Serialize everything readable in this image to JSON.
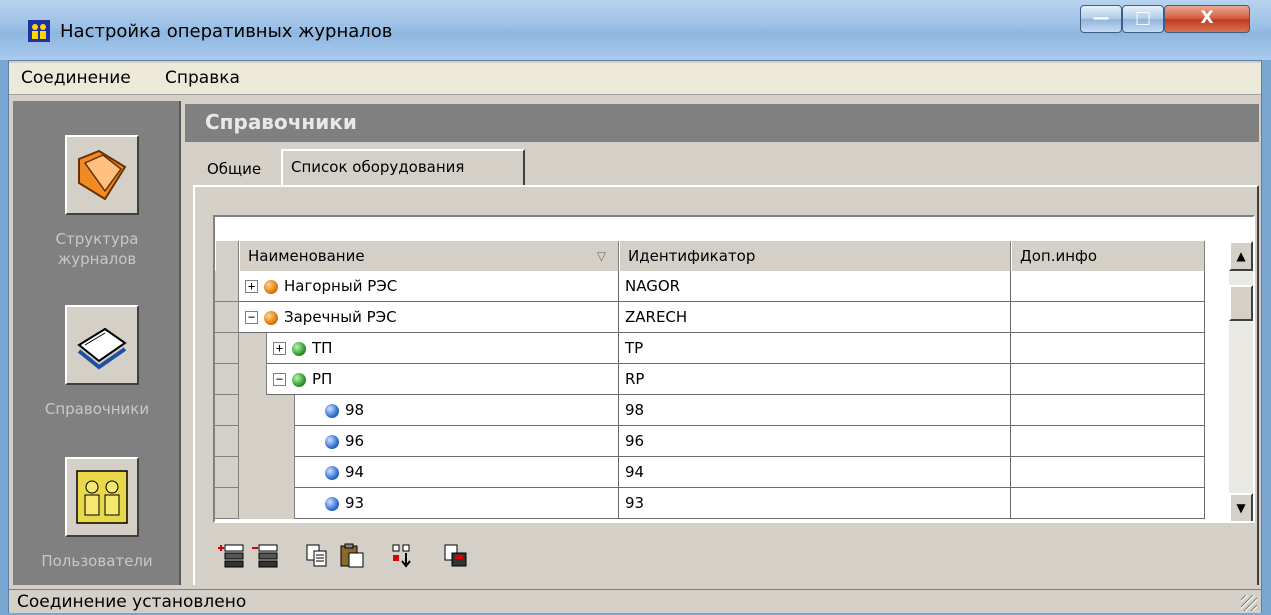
{
  "window": {
    "title": "Настройка оперативных журналов",
    "minimize_glyph": "—",
    "maximize_glyph": "□",
    "close_glyph": "X"
  },
  "menu": {
    "items": [
      "Соединение",
      "Справка"
    ]
  },
  "sidebar": {
    "buttons": [
      {
        "label_line1": "Структура",
        "label_line2": "журналов",
        "icon": "folder-icon"
      },
      {
        "label_line1": "Справочники",
        "label_line2": "",
        "icon": "books-icon"
      },
      {
        "label_line1": "Пользователи",
        "label_line2": "",
        "icon": "users-icon"
      }
    ]
  },
  "panel": {
    "title": "Справочники",
    "tabs": [
      "Общие",
      "Список оборудования"
    ],
    "active_tab": "Список оборудования"
  },
  "grid": {
    "columns": [
      "Наименование",
      "Идентификатор",
      "Доп.инфо"
    ],
    "sort_glyph": "▽",
    "rows": [
      {
        "name": "Нагорный РЭС",
        "id": "NAGOR",
        "extra": "",
        "level": 0,
        "expander": "+",
        "icon": "orange"
      },
      {
        "name": "Заречный РЭС",
        "id": "ZARECH",
        "extra": "",
        "level": 0,
        "expander": "−",
        "icon": "orange"
      },
      {
        "name": "ТП",
        "id": "TP",
        "extra": "",
        "level": 1,
        "expander": "+",
        "icon": "green"
      },
      {
        "name": "РП",
        "id": "RP",
        "extra": "",
        "level": 1,
        "expander": "−",
        "icon": "green"
      },
      {
        "name": "98",
        "id": "98",
        "extra": "",
        "level": 2,
        "expander": "",
        "icon": "blue"
      },
      {
        "name": "96",
        "id": "96",
        "extra": "",
        "level": 2,
        "expander": "",
        "icon": "blue"
      },
      {
        "name": "94",
        "id": "94",
        "extra": "",
        "level": 2,
        "expander": "",
        "icon": "blue"
      },
      {
        "name": "93",
        "id": "93",
        "extra": "",
        "level": 2,
        "expander": "",
        "icon": "blue"
      }
    ],
    "scroll_up_glyph": "▲",
    "scroll_down_glyph": "▼"
  },
  "toolbar": {
    "buttons": [
      "add-record-icon",
      "delete-record-icon",
      "copy-icon",
      "paste-icon",
      "move-down-icon",
      "export-icon"
    ]
  },
  "status": {
    "text": "Соединение установлено"
  }
}
